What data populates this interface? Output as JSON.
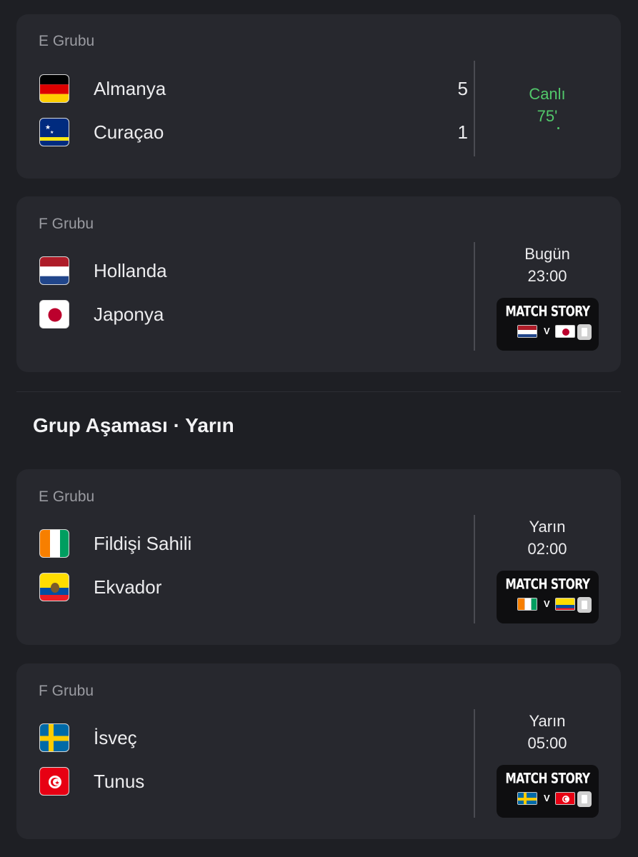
{
  "section": {
    "title": "Grup Aşaması · Yarın"
  },
  "matches": [
    {
      "group": "E Grubu",
      "home": {
        "name": "Almanya",
        "score": "5",
        "flag": "germany-flag"
      },
      "away": {
        "name": "Curaçao",
        "score": "1",
        "flag": "curacao-flag"
      },
      "status_line1": "Canlı",
      "status_line2": "75'",
      "status_color": "#52c96b"
    },
    {
      "group": "F Grubu",
      "home": {
        "name": "Hollanda",
        "flag": "netherlands-flag"
      },
      "away": {
        "name": "Japonya",
        "flag": "japan-flag"
      },
      "status_line1": "Bugün",
      "status_line2": "23:00",
      "story": {
        "title": "MATCH STORY",
        "vs": "V"
      }
    },
    {
      "group": "E Grubu",
      "home": {
        "name": "Fildişi Sahili",
        "flag": "ivory-coast-flag"
      },
      "away": {
        "name": "Ekvador",
        "flag": "ecuador-flag"
      },
      "status_line1": "Yarın",
      "status_line2": "02:00",
      "story": {
        "title": "MATCH STORY",
        "vs": "V"
      }
    },
    {
      "group": "F Grubu",
      "home": {
        "name": "İsveç",
        "flag": "sweden-flag"
      },
      "away": {
        "name": "Tunus",
        "flag": "tunisia-flag"
      },
      "status_line1": "Yarın",
      "status_line2": "05:00",
      "story": {
        "title": "MATCH STORY",
        "vs": "V"
      }
    }
  ],
  "colors": {
    "background": "#1e1f24",
    "card": "#27282e",
    "live": "#52c96b"
  }
}
